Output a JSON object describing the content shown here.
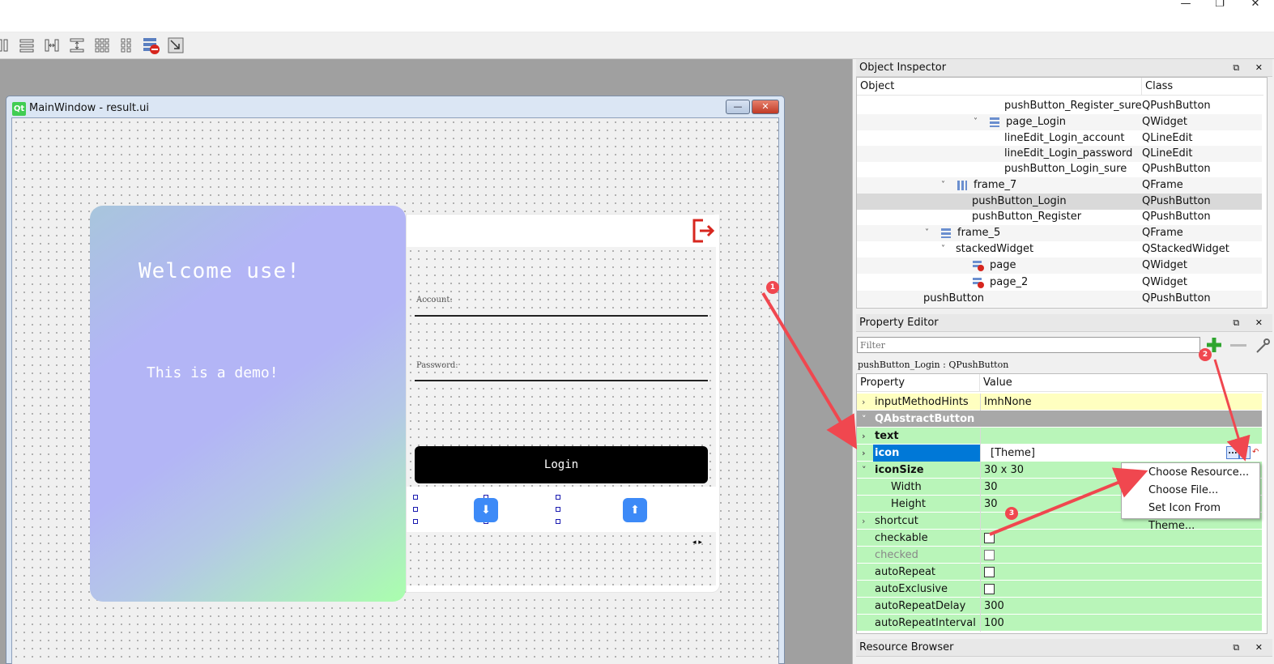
{
  "window_controls": {
    "minimize": "—",
    "maximize": "❐",
    "close": "✕"
  },
  "toolbar": {
    "icons": [
      "layout-horizontal-icon",
      "layout-vertical-icon",
      "splitter-horizontal-icon",
      "splitter-vertical-icon",
      "layout-grid-icon",
      "layout-form-icon",
      "break-layout-icon",
      "adjust-size-icon"
    ]
  },
  "designer": {
    "window_title": "MainWindow - result.ui",
    "qt_logo": "Qt",
    "min_label": "—",
    "close_label": "✕",
    "welcome_text": "Welcome use!",
    "demo_text": "This is a demo!",
    "account_label": "Account:",
    "password_label": "Password:",
    "login_button": "Login",
    "logout_glyph": "⇨",
    "nav_arrows": "◂ ▸",
    "download_glyph": "⬇",
    "upload_glyph": "⬆"
  },
  "object_inspector": {
    "title": "Object Inspector",
    "header": {
      "object": "Object",
      "class": "Class"
    },
    "rows": [
      {
        "name": "pushButton_Register_sure",
        "class": "QPushButton"
      },
      {
        "name": "page_Login",
        "class": "QWidget"
      },
      {
        "name": "lineEdit_Login_account",
        "class": "QLineEdit"
      },
      {
        "name": "lineEdit_Login_password",
        "class": "QLineEdit"
      },
      {
        "name": "pushButton_Login_sure",
        "class": "QPushButton"
      },
      {
        "name": "frame_7",
        "class": "QFrame"
      },
      {
        "name": "pushButton_Login",
        "class": "QPushButton"
      },
      {
        "name": "pushButton_Register",
        "class": "QPushButton"
      },
      {
        "name": "frame_5",
        "class": "QFrame"
      },
      {
        "name": "stackedWidget",
        "class": "QStackedWidget"
      },
      {
        "name": "page",
        "class": "QWidget"
      },
      {
        "name": "page_2",
        "class": "QWidget"
      },
      {
        "name": "pushButton",
        "class": "QPushButton"
      }
    ]
  },
  "property_editor": {
    "title": "Property Editor",
    "filter_placeholder": "Filter",
    "context_label": "pushButton_Login : QPushButton",
    "header": {
      "property": "Property",
      "value": "Value"
    },
    "rows": [
      {
        "name": "inputMethodHints",
        "value": "ImhNone"
      },
      {
        "name": "QAbstractButton",
        "value": ""
      },
      {
        "name": "text",
        "value": ""
      },
      {
        "name": "icon",
        "value": "[Theme]"
      },
      {
        "name": "iconSize",
        "value": "30 x 30"
      },
      {
        "name": "Width",
        "value": "30"
      },
      {
        "name": "Height",
        "value": "30"
      },
      {
        "name": "shortcut",
        "value": ""
      },
      {
        "name": "checkable",
        "value": ""
      },
      {
        "name": "checked",
        "value": ""
      },
      {
        "name": "autoRepeat",
        "value": ""
      },
      {
        "name": "autoExclusive",
        "value": ""
      },
      {
        "name": "autoRepeatDelay",
        "value": "300"
      },
      {
        "name": "autoRepeatInterval",
        "value": "100"
      }
    ],
    "icon_buttons": {
      "browse": "...",
      "dropdown": "▾",
      "reset": "↶"
    }
  },
  "context_menu": {
    "items": [
      "Choose Resource...",
      "Choose File...",
      "Set Icon From Theme..."
    ]
  },
  "resource_browser": {
    "title": "Resource Browser"
  },
  "dock_buttons": "⧉ ✕",
  "annotations": {
    "badges": [
      "1",
      "2",
      "3"
    ],
    "arrow_color": "#f0474f"
  },
  "colors": {
    "selection": "#0078d7",
    "category_bg": "#a8a8a8",
    "property_green": "#b9f5b9",
    "property_yellow": "#ffffc0"
  }
}
